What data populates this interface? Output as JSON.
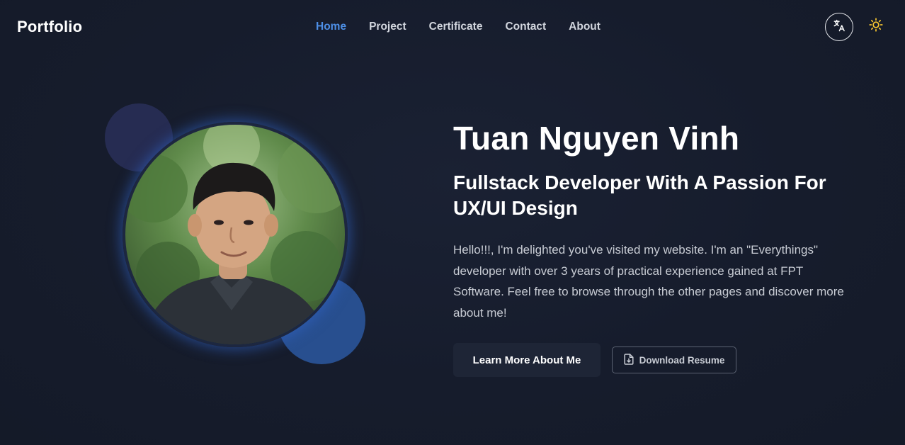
{
  "header": {
    "brand": "Portfolio",
    "nav": [
      {
        "label": "Home",
        "active": true
      },
      {
        "label": "Project",
        "active": false
      },
      {
        "label": "Certificate",
        "active": false
      },
      {
        "label": "Contact",
        "active": false
      },
      {
        "label": "About",
        "active": false
      }
    ],
    "language_icon": "translate-icon",
    "theme_icon": "sun-icon"
  },
  "hero": {
    "name": "Tuan Nguyen Vinh",
    "subtitle": "Fullstack Developer With A Passion For UX/UI Design",
    "intro": "Hello!!!, I'm delighted you've visited my website. I'm an \"Everythings\" developer with over 3 years of practical experience gained at FPT Software. Feel free to browse through the other pages and discover more about me!",
    "primary_button": "Learn More About Me",
    "secondary_button": "Download Resume",
    "secondary_button_icon": "file-download-icon"
  },
  "colors": {
    "background": "#151b2b",
    "accent": "#4d8fe6",
    "blob_dark": "#262c52",
    "blob_blue": "#284f8f"
  }
}
